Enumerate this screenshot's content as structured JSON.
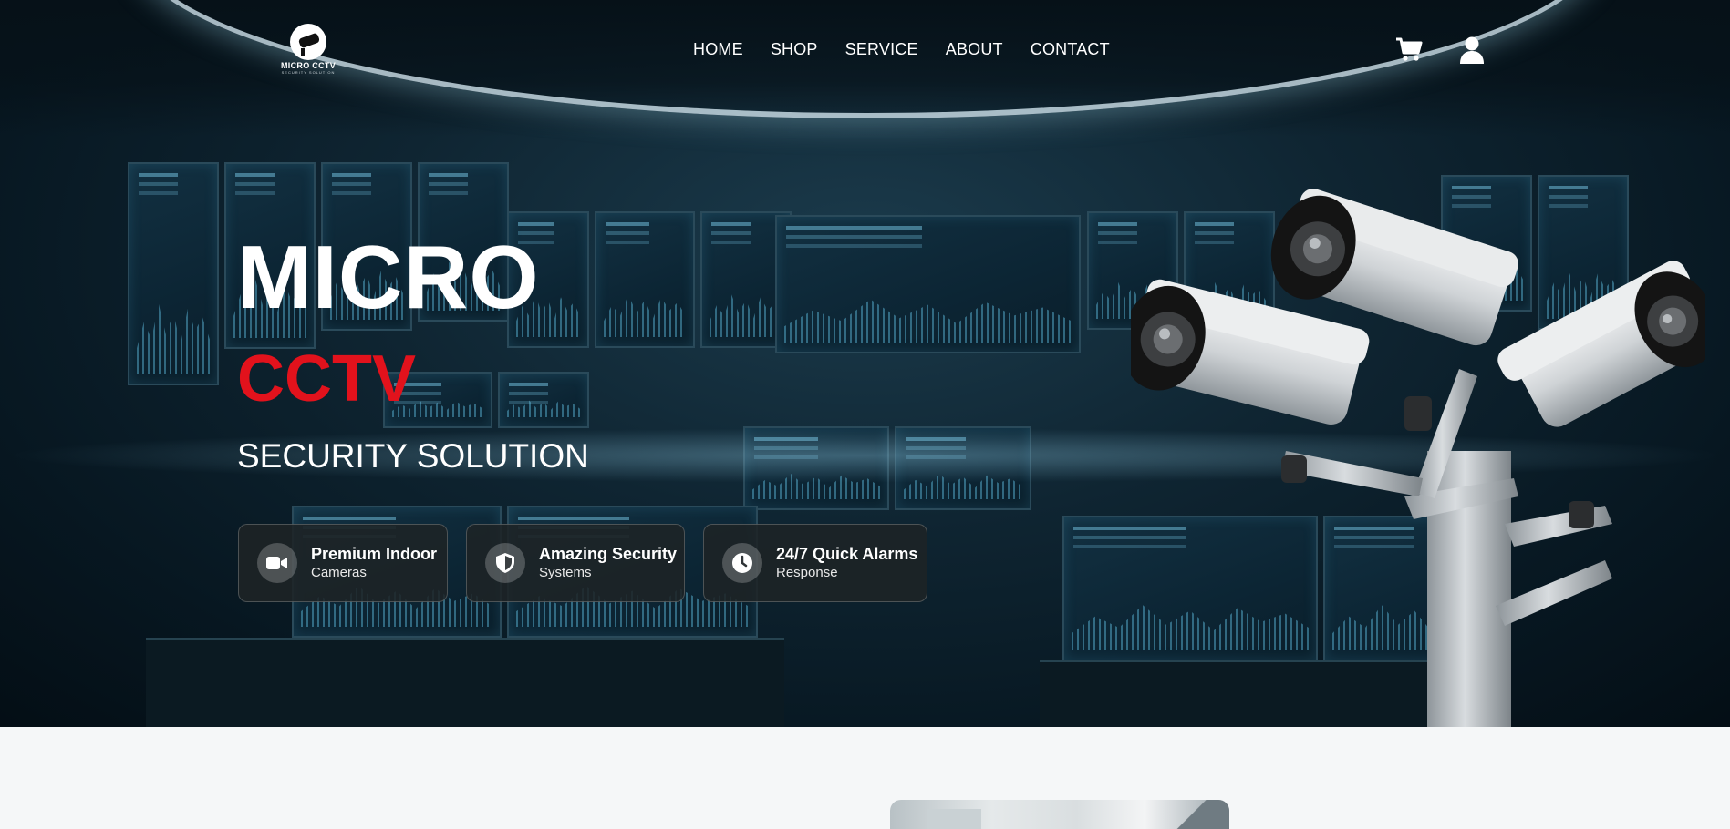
{
  "logo": {
    "text": "MICRO CCTV",
    "sub": "SECURITY SOLUTION"
  },
  "nav": {
    "items": [
      "HOME",
      "SHOP",
      "SERVICE",
      "ABOUT",
      "CONTACT"
    ]
  },
  "icons": {
    "cart": "cart-icon",
    "user": "user-icon"
  },
  "hero": {
    "title": "MICRO",
    "accent": "CCTV",
    "subtitle": "SECURITY SOLUTION",
    "accent_color": "#e2121c",
    "features": [
      {
        "icon": "video-camera-icon",
        "title": "Premium Indoor",
        "desc": "Cameras"
      },
      {
        "icon": "shield-icon",
        "title": "Amazing Security",
        "desc": "Systems"
      },
      {
        "icon": "clock-icon",
        "title": "24/7 Quick Alarms",
        "desc": "Response"
      }
    ]
  }
}
